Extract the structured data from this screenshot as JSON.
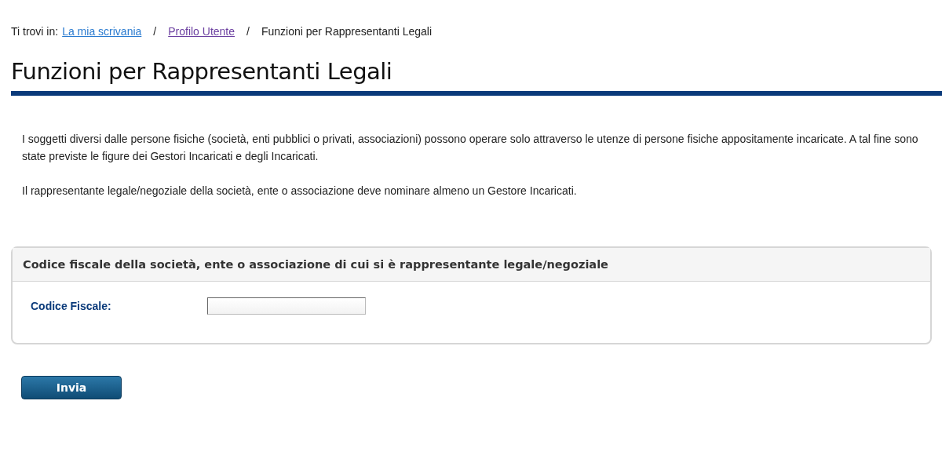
{
  "breadcrumb": {
    "prefix": "Ti trovi in:",
    "items": [
      {
        "label": "La mia scrivania",
        "kind": "link",
        "visited": false
      },
      {
        "label": "Profilo Utente",
        "kind": "link",
        "visited": true
      },
      {
        "label": "Funzioni per Rappresentanti Legali",
        "kind": "current"
      }
    ],
    "separator": "/"
  },
  "title": "Funzioni per Rappresentanti Legali",
  "paragraphs": [
    "I soggetti diversi dalle persone fisiche (società, enti pubblici o privati, associazioni) possono operare solo attraverso le utenze di persone fisiche appositamente incaricate. A tal fine sono state previste le figure dei Gestori Incaricati e degli Incaricati.",
    "Il rappresentante legale/negoziale della società, ente o associazione deve nominare almeno un Gestore Incaricati."
  ],
  "panel": {
    "title": "Codice fiscale della società, ente o associazione di cui si è rappresentante legale/negoziale",
    "fields": [
      {
        "label": "Codice Fiscale:"
      }
    ]
  },
  "buttons": [
    "Invia"
  ]
}
